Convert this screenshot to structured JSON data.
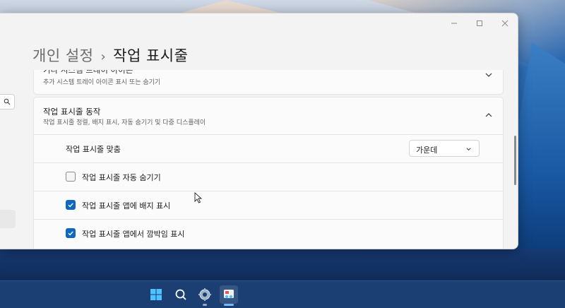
{
  "window": {
    "breadcrumb_parent": "개인 설정",
    "breadcrumb_sep": "›",
    "breadcrumb_current": "작업 표시줄"
  },
  "tray_section": {
    "title": "기타 시스템 트레이 아이콘",
    "subtitle": "추가 시스템 트레이 아이콘 표시 또는 숨기기"
  },
  "taskbar_behaviors": {
    "title": "작업 표시줄 동작",
    "subtitle": "작업 표시줄 정렬, 배지 표시, 자동 숨기기 및 다중 디스플레이",
    "alignment_label": "작업 표시줄 맞춤",
    "alignment_value": "가운데",
    "options": [
      {
        "label": "작업 표시줄 자동 숨기기",
        "checked": false
      },
      {
        "label": "작업 표시줄 앱에 배지 표시",
        "checked": true
      },
      {
        "label": "작업 표시줄 앱에서 깜박임 표시",
        "checked": true
      }
    ]
  },
  "colors": {
    "accent": "#0f67c0",
    "window_bg": "#f3f3f3",
    "card_bg": "#fbfbfb",
    "taskbar_bg": "#1c3f73"
  },
  "os_taskbar": {
    "icons": [
      "start-icon",
      "search-icon",
      "settings-gear-icon",
      "snipping-tool-icon"
    ],
    "active": "snipping-tool-icon"
  }
}
